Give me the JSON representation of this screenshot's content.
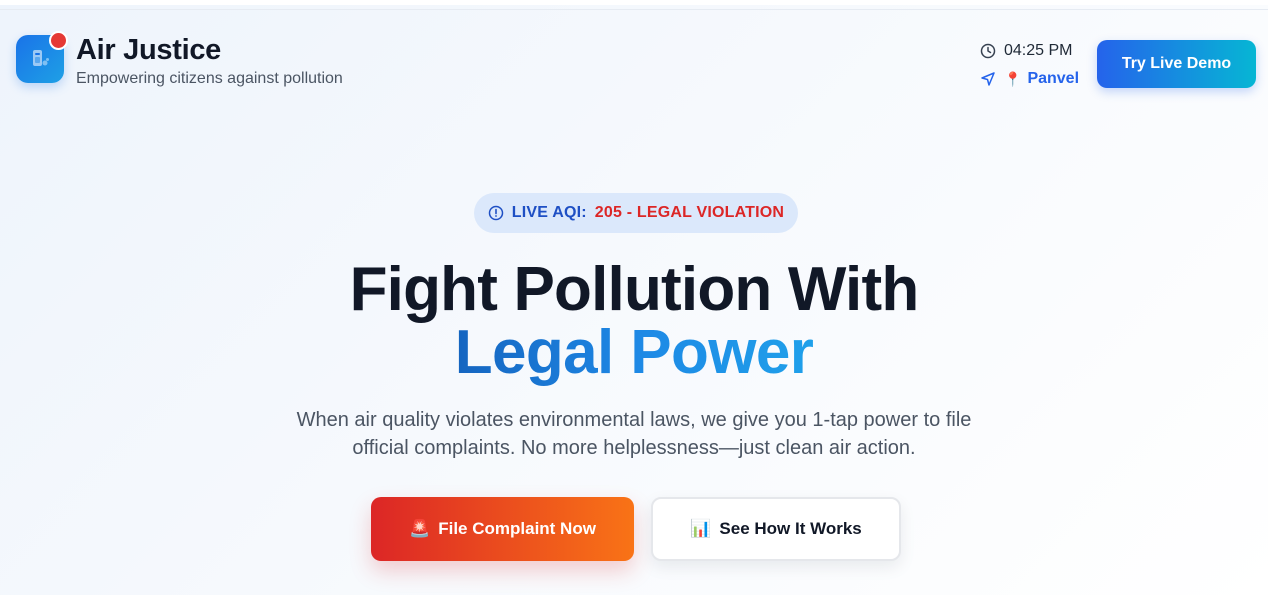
{
  "app": {
    "name": "Air Justice",
    "tagline": "Empowering citizens against pollution",
    "logo_icon": "air-purifier-icon"
  },
  "header": {
    "time": "04:25 PM",
    "location_pin": "📍",
    "location": "Panvel",
    "demo_button": "Try Live Demo"
  },
  "hero": {
    "aqi_label": "LIVE AQI:",
    "aqi_value": "205 - LEGAL VIOLATION",
    "title_line1": "Fight Pollution With",
    "title_line2": "Legal Power",
    "description": "When air quality violates environmental laws, we give you 1-tap power to file official complaints. No more helplessness—just clean air action.",
    "primary_cta": {
      "icon": "🚨",
      "label": "File Complaint Now"
    },
    "secondary_cta": {
      "icon": "📊",
      "label": "See How It Works"
    }
  },
  "colors": {
    "brand_blue": "#1a73e8",
    "accent_cyan": "#06b6d4",
    "danger_red": "#dc2626",
    "orange": "#f97316",
    "text_dark": "#111827"
  }
}
